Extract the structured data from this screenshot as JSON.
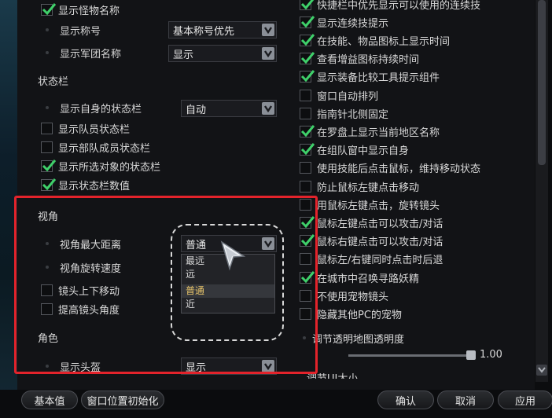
{
  "left": {
    "top_rows": [
      {
        "label": "显示怪物名称",
        "type": "checkbox",
        "checked": true
      },
      {
        "label": "显示称号",
        "type": "dropdown",
        "value": "基本称号优先"
      },
      {
        "label": "显示军团名称",
        "type": "dropdown",
        "value": "显示"
      }
    ],
    "status_section": {
      "title": "状态栏",
      "rows": [
        {
          "label": "显示自身的状态栏",
          "type": "dropdown",
          "value": "自动"
        },
        {
          "label": "显示队员状态栏",
          "type": "checkbox",
          "checked": false
        },
        {
          "label": "显示部队成员状态栏",
          "type": "checkbox",
          "checked": false
        },
        {
          "label": "显示所选对象的状态栏",
          "type": "checkbox",
          "checked": true
        },
        {
          "label": "显示状态栏数值",
          "type": "checkbox",
          "checked": true
        }
      ]
    },
    "camera_section": {
      "title": "视角",
      "rows": [
        {
          "label": "视角最大距离",
          "type": "dropdown",
          "value": "普通"
        },
        {
          "label": "视角旋转速度",
          "type": "dropdown",
          "value": ""
        },
        {
          "label": "镜头上下移动",
          "type": "checkbox",
          "checked": false
        },
        {
          "label": "提高镜头角度",
          "type": "checkbox",
          "checked": false
        }
      ],
      "dropdown_options": [
        "最远",
        "远",
        "普通",
        "近"
      ],
      "dropdown_selected": "普通"
    },
    "character_section": {
      "title": "角色",
      "rows": [
        {
          "label": "显示头盔",
          "type": "dropdown",
          "value": "显示"
        }
      ]
    }
  },
  "right": {
    "rows": [
      {
        "label": "快捷栏中优先显示可以使用的连续技",
        "checked": true
      },
      {
        "label": "显示连续技提示",
        "checked": true
      },
      {
        "label": "在技能、物品图标上显示时间",
        "checked": true
      },
      {
        "label": "查看增益图标持续时间",
        "checked": true
      },
      {
        "label": "显示装备比较工具提示组件",
        "checked": true
      },
      {
        "label": "窗口自动排列",
        "checked": false
      },
      {
        "label": "指南针北侧固定",
        "checked": false
      },
      {
        "label": "在罗盘上显示当前地区名称",
        "checked": true
      },
      {
        "label": "在组队窗中显示自身",
        "checked": true
      },
      {
        "label": "使用技能后点击鼠标，维持移动状态",
        "checked": false
      },
      {
        "label": "防止鼠标左键点击移动",
        "checked": false
      },
      {
        "label": "用鼠标左键点击，旋转镜头",
        "checked": false
      },
      {
        "label": "鼠标左键点击可以攻击/对话",
        "checked": true
      },
      {
        "label": "鼠标右键点击可以攻击/对话",
        "checked": true
      },
      {
        "label": "鼠标左/右键同时点击时后退",
        "checked": false
      },
      {
        "label": "在城市中召唤寻路妖精",
        "checked": true
      },
      {
        "label": "不使用宠物镜头",
        "checked": false
      },
      {
        "label": "隐藏其他PC的宠物",
        "checked": false
      }
    ],
    "map_transparency": {
      "label": "调节透明地图透明度",
      "value": "1.00",
      "level": 1.0
    },
    "partial_label": "调节UI大小"
  },
  "footer": {
    "default_label": "基本值",
    "reset_window_label": "窗口位置初始化",
    "confirm_label": "确认",
    "cancel_label": "取消",
    "apply_label": "应用"
  },
  "colors": {
    "highlight_frame": "#e3232b",
    "check": "#3fd06a",
    "selected_option": "#e8c46a"
  }
}
